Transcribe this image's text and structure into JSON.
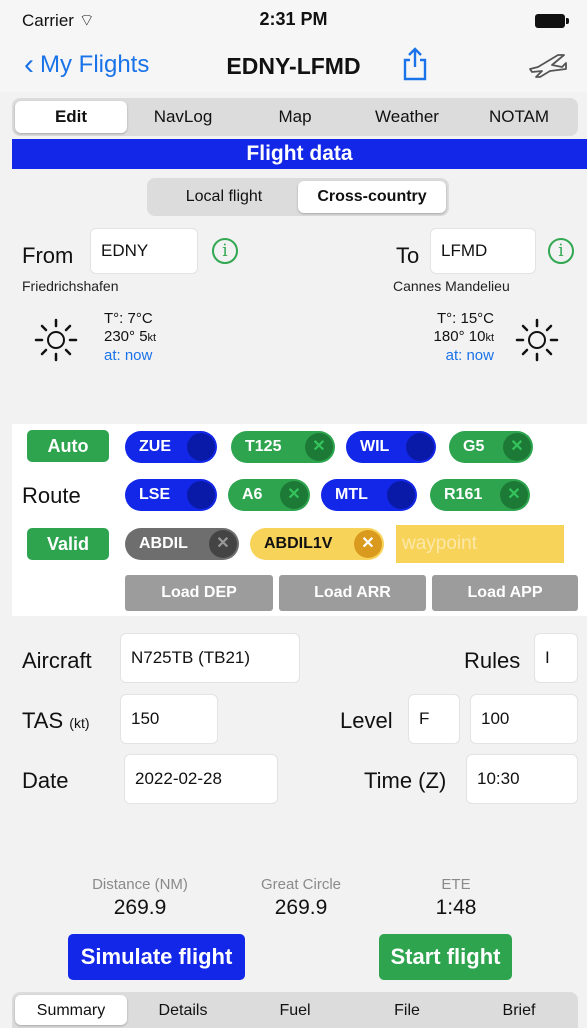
{
  "status": {
    "carrier": "Carrier",
    "time": "2:31 PM"
  },
  "nav": {
    "back": "My Flights",
    "title": "EDNY-LFMD"
  },
  "tabs": [
    "Edit",
    "NavLog",
    "Map",
    "Weather",
    "NOTAM"
  ],
  "section_title": "Flight data",
  "mode": {
    "local": "Local flight",
    "cross": "Cross-country"
  },
  "from": {
    "label": "From",
    "code": "EDNY",
    "name": "Friedrichshafen",
    "temp": "T°: 7°C",
    "wind": "230° 5",
    "unit": "kt",
    "at": "at: now"
  },
  "to": {
    "label": "To",
    "code": "LFMD",
    "name": "Cannes Mandelieu",
    "temp": "T°: 15°C",
    "wind": "180° 10",
    "unit": "kt",
    "at": "at: now"
  },
  "route": {
    "auto": "Auto",
    "label": "Route",
    "valid": "Valid",
    "row1": [
      "ZUE",
      "T125",
      "WIL",
      "G5"
    ],
    "row2": [
      "LSE",
      "A6",
      "MTL",
      "R161"
    ],
    "row3": [
      "ABDIL",
      "ABDIL1V"
    ],
    "waypoint_placeholder": "waypoint",
    "load_dep": "Load DEP",
    "load_arr": "Load ARR",
    "load_app": "Load APP"
  },
  "aircraft": {
    "label": "Aircraft",
    "value": "N725TB (TB21)"
  },
  "rules": {
    "label": "Rules",
    "value": "I"
  },
  "tas": {
    "label": "TAS",
    "unit": "(kt)",
    "value": "150"
  },
  "level": {
    "label": "Level",
    "type": "F",
    "value": "100"
  },
  "date": {
    "label": "Date",
    "value": "2022-02-28"
  },
  "time": {
    "label": "Time (Z)",
    "value": "10:30"
  },
  "stats": {
    "distance_label": "Distance (NM)",
    "distance": "269.9",
    "gc_label": "Great Circle",
    "gc": "269.9",
    "ete_label": "ETE",
    "ete": "1:48"
  },
  "buttons": {
    "simulate": "Simulate flight",
    "start": "Start flight"
  },
  "bottom_tabs": [
    "Summary",
    "Details",
    "Fuel",
    "File",
    "Brief"
  ],
  "colors": {
    "blue": "#1327e8",
    "green": "#2ea44f",
    "yellow": "#f7d35a",
    "link": "#1a73e8"
  }
}
